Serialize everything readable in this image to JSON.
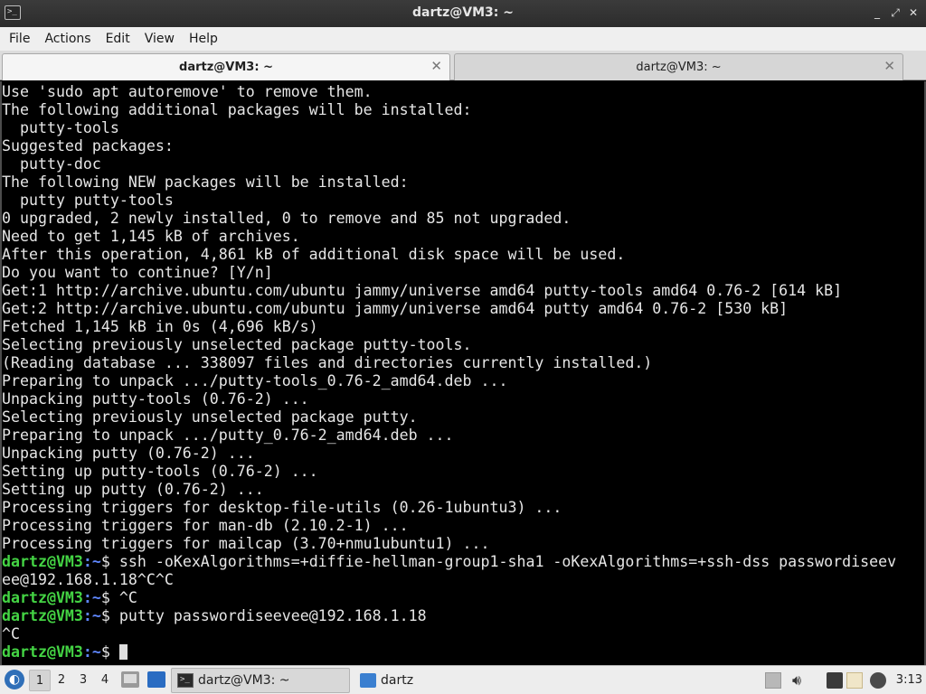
{
  "window": {
    "title": "dartz@VM3: ~",
    "controls": {
      "minimize": "_",
      "maximize": "⤢",
      "close": "✕"
    }
  },
  "menubar": [
    "File",
    "Actions",
    "Edit",
    "View",
    "Help"
  ],
  "tabs": [
    {
      "label": "dartz@VM3: ~",
      "active": true
    },
    {
      "label": "dartz@VM3: ~",
      "active": false
    }
  ],
  "terminal": {
    "prompt_user": "dartz@VM3",
    "prompt_path": ":~",
    "prompt_symbol": "$",
    "lines": [
      {
        "text": "Use 'sudo apt autoremove' to remove them."
      },
      {
        "text": "The following additional packages will be installed:"
      },
      {
        "text": "  putty-tools"
      },
      {
        "text": "Suggested packages:"
      },
      {
        "text": "  putty-doc"
      },
      {
        "text": "The following NEW packages will be installed:"
      },
      {
        "text": "  putty putty-tools"
      },
      {
        "text": "0 upgraded, 2 newly installed, 0 to remove and 85 not upgraded."
      },
      {
        "text": "Need to get 1,145 kB of archives."
      },
      {
        "text": "After this operation, 4,861 kB of additional disk space will be used."
      },
      {
        "text": "Do you want to continue? [Y/n]"
      },
      {
        "text": "Get:1 http://archive.ubuntu.com/ubuntu jammy/universe amd64 putty-tools amd64 0.76-2 [614 kB]"
      },
      {
        "text": "Get:2 http://archive.ubuntu.com/ubuntu jammy/universe amd64 putty amd64 0.76-2 [530 kB]"
      },
      {
        "text": "Fetched 1,145 kB in 0s (4,696 kB/s)"
      },
      {
        "text": "Selecting previously unselected package putty-tools."
      },
      {
        "text": "(Reading database ... 338097 files and directories currently installed.)"
      },
      {
        "text": "Preparing to unpack .../putty-tools_0.76-2_amd64.deb ..."
      },
      {
        "text": "Unpacking putty-tools (0.76-2) ..."
      },
      {
        "text": "Selecting previously unselected package putty."
      },
      {
        "text": "Preparing to unpack .../putty_0.76-2_amd64.deb ..."
      },
      {
        "text": "Unpacking putty (0.76-2) ..."
      },
      {
        "text": "Setting up putty-tools (0.76-2) ..."
      },
      {
        "text": "Setting up putty (0.76-2) ..."
      },
      {
        "text": "Processing triggers for desktop-file-utils (0.26-1ubuntu3) ..."
      },
      {
        "text": "Processing triggers for man-db (2.10.2-1) ..."
      },
      {
        "text": "Processing triggers for mailcap (3.70+nmu1ubuntu1) ..."
      },
      {
        "prompt": true,
        "text": " ssh -oKexAlgorithms=+diffie-hellman-group1-sha1 -oKexAlgorithms=+ssh-dss passwordiseev"
      },
      {
        "text": "ee@192.168.1.18^C^C"
      },
      {
        "prompt": true,
        "text": " ^C"
      },
      {
        "prompt": true,
        "text": " putty passwordiseevee@192.168.1.18"
      },
      {
        "text": "^C"
      },
      {
        "prompt": true,
        "text": " ",
        "cursor": true
      }
    ]
  },
  "panel": {
    "workspaces": [
      "1",
      "2",
      "3",
      "4"
    ],
    "active_workspace": "1",
    "tasks": [
      {
        "label": "dartz@VM3: ~",
        "icon": "terminal-icon"
      },
      {
        "label": "dartz",
        "icon": "folder-icon"
      }
    ],
    "clock": "3:13"
  }
}
